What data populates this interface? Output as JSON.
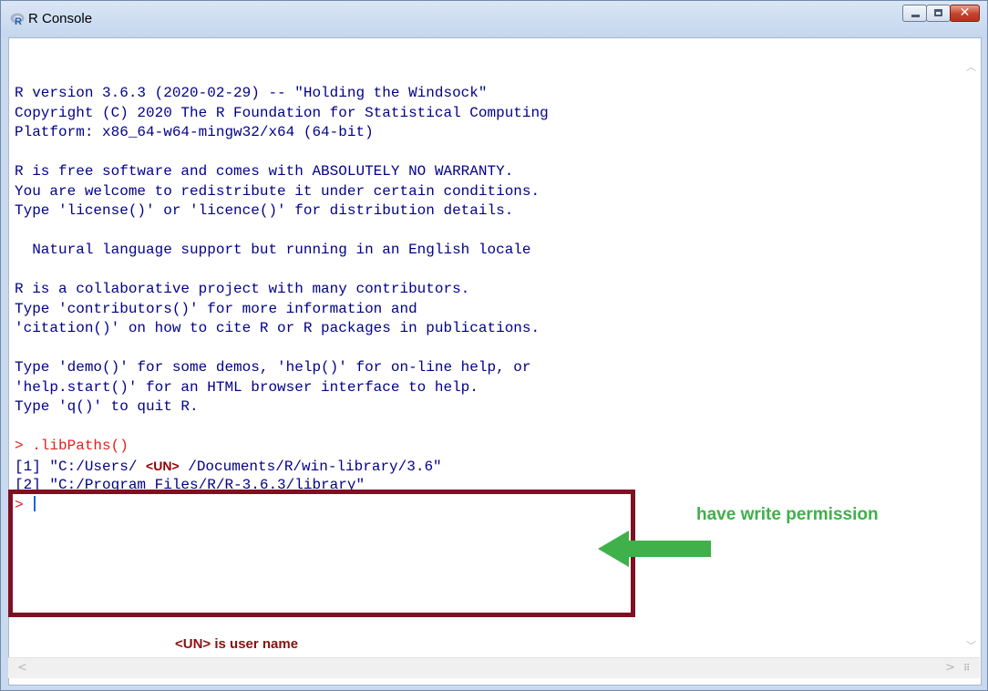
{
  "window": {
    "title": "R Console",
    "buttons": {
      "minimize": "minimize",
      "maximize": "maximize",
      "close": "✕"
    }
  },
  "console": {
    "lines": [
      "R version 3.6.3 (2020-02-29) -- \"Holding the Windsock\"",
      "Copyright (C) 2020 The R Foundation for Statistical Computing",
      "Platform: x86_64-w64-mingw32/x64 (64-bit)",
      "",
      "R is free software and comes with ABSOLUTELY NO WARRANTY.",
      "You are welcome to redistribute it under certain conditions.",
      "Type 'license()' or 'licence()' for distribution details.",
      "",
      "  Natural language support but running in an English locale",
      "",
      "R is a collaborative project with many contributors.",
      "Type 'contributors()' for more information and",
      "'citation()' on how to cite R or R packages in publications.",
      "",
      "Type 'demo()' for some demos, 'help()' for on-line help, or",
      "'help.start()' for an HTML browser interface to help.",
      "Type 'q()' to quit R.",
      ""
    ],
    "command": "> .libPaths()",
    "result1_prefix": "[1] \"C:/Users/ ",
    "result1_un": "<UN>",
    "result1_suffix": " /Documents/R/win-library/3.6\"",
    "result2": "[2] \"C:/Program Files/R/R-3.6.3/library\"",
    "prompt": "> "
  },
  "annotations": {
    "write_permission": "have write permission",
    "un_note": "<UN> is user name",
    "arrow_color": "#3fb04a",
    "box_color": "#7f1022"
  },
  "colors": {
    "console_text": "#00008b",
    "prompt_text": "#e0201b"
  }
}
